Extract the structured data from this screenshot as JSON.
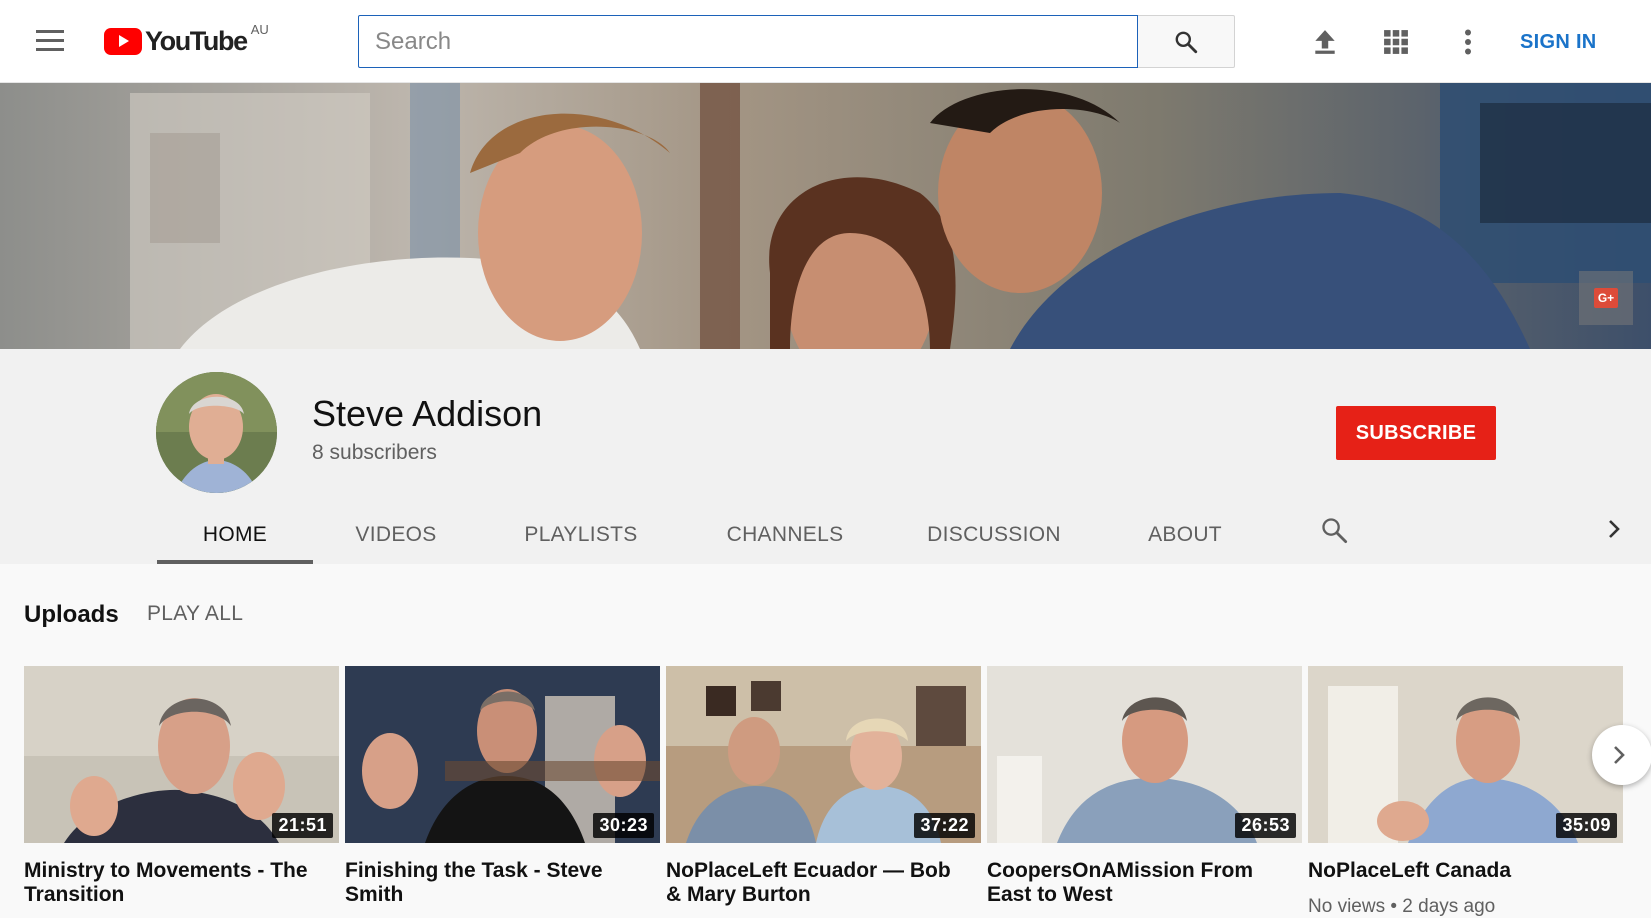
{
  "masthead": {
    "logo_text": "YouTube",
    "country_code": "AU",
    "search_placeholder": "Search",
    "search_value": "",
    "sign_in_label": "SIGN IN",
    "icons": [
      "menu-icon",
      "upload-icon",
      "apps-grid-icon",
      "more-vert-icon",
      "search-icon"
    ]
  },
  "banner": {
    "gplus_label": "G+"
  },
  "channel": {
    "name": "Steve Addison",
    "subscribers": "8 subscribers",
    "subscribe_label": "SUBSCRIBE",
    "tabs": [
      {
        "label": "HOME",
        "active": true
      },
      {
        "label": "VIDEOS",
        "active": false
      },
      {
        "label": "PLAYLISTS",
        "active": false
      },
      {
        "label": "CHANNELS",
        "active": false
      },
      {
        "label": "DISCUSSION",
        "active": false
      },
      {
        "label": "ABOUT",
        "active": false
      }
    ]
  },
  "uploads": {
    "title": "Uploads",
    "play_all_label": "PLAY ALL",
    "videos": [
      {
        "title": "Ministry to Movements - The Transition",
        "duration": "21:51",
        "meta": ""
      },
      {
        "title": "Finishing the Task - Steve Smith",
        "duration": "30:23",
        "meta": ""
      },
      {
        "title": "NoPlaceLeft Ecuador — Bob & Mary Burton",
        "duration": "37:22",
        "meta": ""
      },
      {
        "title": "CoopersOnAMission From East to West",
        "duration": "26:53",
        "meta": ""
      },
      {
        "title": "NoPlaceLeft Canada",
        "duration": "35:09",
        "meta": "No views • 2 days ago"
      }
    ]
  },
  "colors": {
    "brand_red": "#ff0000",
    "subscribe_red": "#e62117",
    "link_blue": "#1a73c9",
    "text_secondary": "#606060"
  }
}
